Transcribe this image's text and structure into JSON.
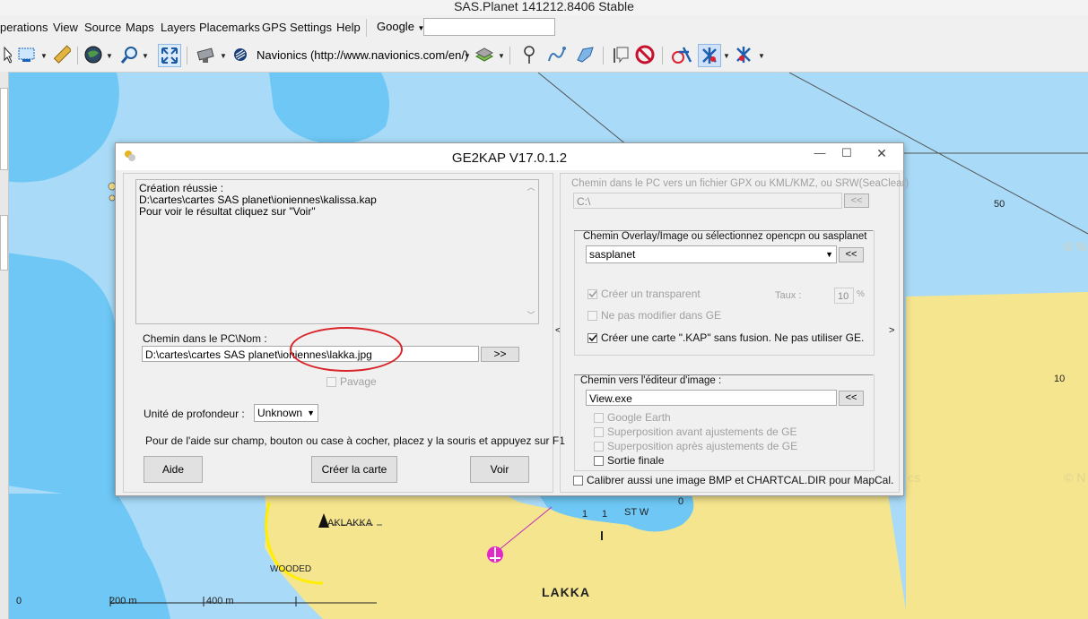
{
  "window": {
    "title": "SAS.Planet 141212.8406 Stable"
  },
  "menubar": {
    "items": [
      "perations",
      "View",
      "Source",
      "Maps",
      "Layers",
      "Placemarks",
      "GPS",
      "Settings",
      "Help"
    ],
    "search_provider": "Google"
  },
  "toolbar": {
    "map_source": "Navionics (http://www.navionics.com/en/)"
  },
  "map": {
    "labels": {
      "lakka_light": "AKLAKKA",
      "wooded": "WOODED",
      "lakka_town": "LAKKA",
      "depth_50": "50",
      "depth_10": "10",
      "depth_0_6": "0",
      "depth_15": "1",
      "depth_17": "1",
      "stw": "ST W",
      "watermark_1": "© N",
      "watermark_2": "© N",
      "watermark_3": "cs"
    },
    "scale": {
      "zero": "0",
      "m200": "200 m",
      "m400": "400 m"
    }
  },
  "dialog": {
    "title": "GE2KAP V17.0.1.2",
    "log_lines": [
      "Création réussie :",
      "D:\\cartes\\cartes SAS planet\\ioniennes\\kalissa.kap",
      "Pour voir le résultat cliquez sur \"Voir\""
    ],
    "path_label": "Chemin dans le PC\\Nom :",
    "path_value": "D:\\cartes\\cartes SAS planet\\ioniennes\\lakka.jpg",
    "browse_btn": ">>",
    "pavage_label": "Pavage",
    "depth_unit_label": "Unité de profondeur :",
    "depth_unit_value": "Unknown",
    "help_text": "Pour de l'aide sur champ, bouton ou case à cocher, placez y la souris et appuyez sur F1",
    "buttons": {
      "aide": "Aide",
      "create": "Créer la carte",
      "voir": "Voir"
    },
    "collapse_left": "<",
    "collapse_right": ">",
    "right": {
      "gpx_label": "Chemin dans le PC vers un fichier GPX ou KML/KMZ, ou SRW(SeaClear)",
      "gpx_value": "C:\\",
      "gpx_btn": "<<",
      "overlay_group": "Chemin  Overlay/Image ou sélectionnez opencpn ou sasplanet",
      "overlay_value": "sasplanet",
      "overlay_btn": "<<",
      "transparent_label": "Créer un transparent",
      "taux_label": "Taux :",
      "taux_value": "10",
      "taux_unit": "%",
      "no_modify_label": "Ne pas modifier dans GE",
      "kap_label": "Créer une carte \".KAP\" sans fusion. Ne pas utiliser GE.",
      "editor_group": "Chemin vers l'éditeur d'image :",
      "editor_value": "View.exe",
      "editor_btn": "<<",
      "opt_google_earth": "Google Earth",
      "opt_before": "Superposition avant ajustements de GE",
      "opt_after": "Superposition après ajustements de GE",
      "opt_final": "Sortie finale",
      "calibrate_label": "Calibrer aussi une image BMP et CHARTCAL.DIR pour MapCal."
    },
    "checks": {
      "transparent": true,
      "kap": true,
      "no_modify": false,
      "pavage": false,
      "final": false,
      "calibrate": false
    }
  },
  "colors": {
    "land": "#f5e58e",
    "shallow": "#a9dbf8",
    "deep": "#6ec7f4",
    "annotation": "#d9252a"
  }
}
